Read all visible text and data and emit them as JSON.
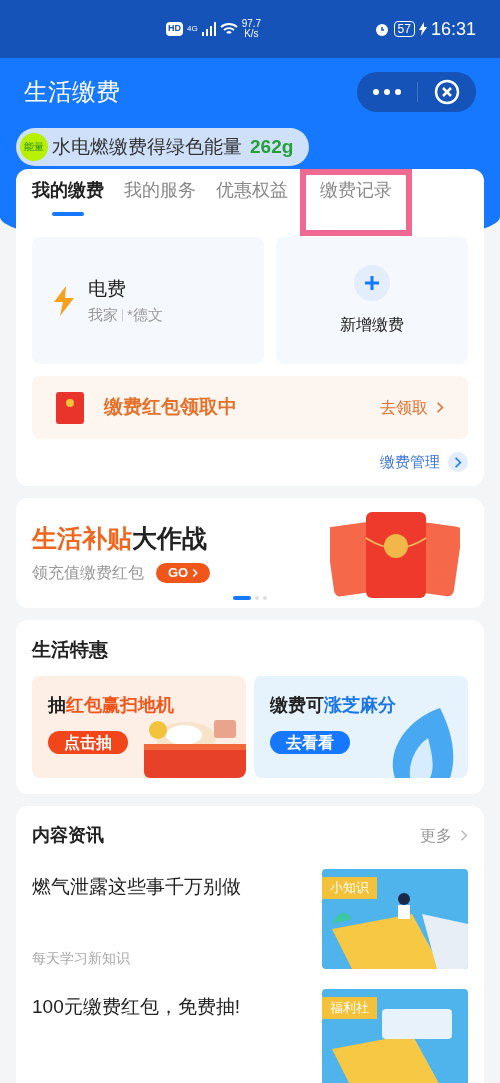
{
  "status_bar": {
    "net_badge": "HD",
    "net_type": "4G",
    "speed_value": "97.7",
    "speed_unit": "K/s",
    "battery": "57",
    "time": "16:31"
  },
  "header": {
    "title": "生活缴费"
  },
  "energy_pill": {
    "badge": "能量",
    "text": "水电燃缴费得绿色能量",
    "amount": "262g"
  },
  "tabs": [
    {
      "label": "我的缴费",
      "selected": true,
      "highlighted": false
    },
    {
      "label": "我的服务",
      "selected": false,
      "highlighted": false
    },
    {
      "label": "优惠权益",
      "selected": false,
      "highlighted": false
    },
    {
      "label": "缴费记录",
      "selected": false,
      "highlighted": true
    }
  ],
  "bill": {
    "title": "电费",
    "account": "我家",
    "holder": "*德文"
  },
  "add_bill": {
    "label": "新增缴费"
  },
  "red_packet": {
    "text": "缴费红包领取中",
    "action": "去领取"
  },
  "manage_link": "缴费管理",
  "banner": {
    "title_accent": "生活补贴",
    "title_rest": "大作战",
    "subtitle": "领充值缴费红包",
    "go": "GO",
    "dots": [
      {
        "selected": true
      },
      {
        "selected": false
      },
      {
        "selected": false
      }
    ]
  },
  "deals": {
    "title": "生活特惠",
    "items": [
      {
        "kind": "orange",
        "lead": "抽",
        "accent": "红包赢扫地机",
        "button": "点击抽"
      },
      {
        "kind": "blue",
        "lead": "缴费可",
        "accent": "涨芝麻分",
        "button": "去看看"
      }
    ]
  },
  "news": {
    "title": "内容资讯",
    "more": "更多",
    "items": [
      {
        "title": "燃气泄露这些事千万别做",
        "subtitle": "每天学习新知识",
        "tag": "小知识"
      },
      {
        "title": "100元缴费红包，免费抽!",
        "tag": "福利社"
      }
    ]
  }
}
